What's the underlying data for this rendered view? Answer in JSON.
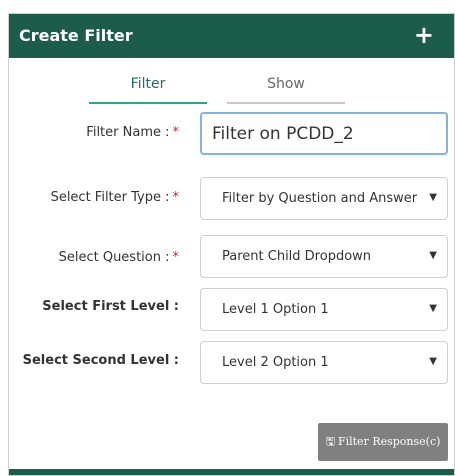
{
  "header": {
    "title": "Create Filter",
    "add_icon": "plus-icon",
    "add_glyph": "+"
  },
  "tabs": [
    {
      "label": "Filter",
      "active": true
    },
    {
      "label": "Show",
      "active": false
    }
  ],
  "form": {
    "filter_name_label": "Filter Name :",
    "filter_name_value": "Filter on PCDD_2",
    "filter_type_label": "Select Filter Type :",
    "filter_type_value": "Filter by Question and Answer",
    "question_label": "Select Question :",
    "question_value": "Parent Child Dropdown",
    "first_level_label": "Select First Level :",
    "first_level_value": "Level 1 Option 1",
    "second_level_label": "Select Second Level :",
    "second_level_value": "Level 2 Option 1",
    "required_mark": "*",
    "dropdown_glyph": "▼"
  },
  "footer": {
    "filter_button_label": "Filter Response(c)",
    "filter_button_icon": "save-icon",
    "filter_button_glyph": "🖫"
  },
  "colors": {
    "header_bg": "#1c5c4a",
    "tab_active_underline": "#27a88c",
    "required": "#d9232e",
    "input_focus_border": "#7fb3e6",
    "button_bg": "#808080"
  }
}
